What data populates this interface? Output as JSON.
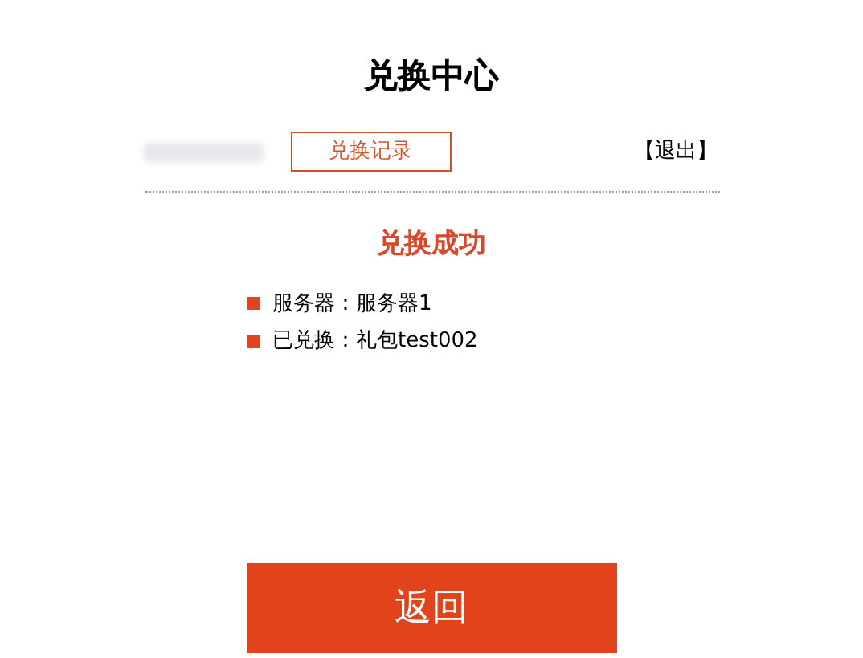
{
  "title": "兑换中心",
  "header": {
    "history_button": "兑换记录",
    "logout_link": "【退出】"
  },
  "result": {
    "heading": "兑换成功",
    "items": [
      {
        "text": "服务器：服务器1"
      },
      {
        "text": "已兑换：礼包test002"
      }
    ]
  },
  "back_button": "返回"
}
